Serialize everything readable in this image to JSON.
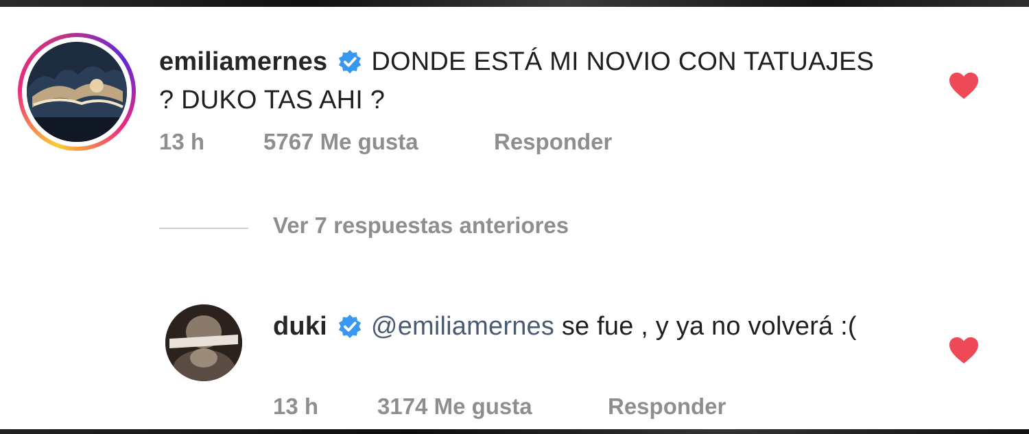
{
  "comments": [
    {
      "username": "emiliamernes",
      "text": "DONDE ESTÁ MI NOVIO CON TATUAJES ? DUKO TAS AHI ?",
      "time": "13 h",
      "likes": "5767 Me gusta",
      "reply_label": "Responder",
      "liked": true
    }
  ],
  "view_replies_label": "Ver 7 respuestas anteriores",
  "reply": {
    "username": "duki",
    "mention": "@emiliamernes",
    "text": " se fue , y ya no volverá :(",
    "time": "13 h",
    "likes": "3174 Me gusta",
    "reply_label": "Responder",
    "liked": true
  },
  "colors": {
    "heart": "#ed4956",
    "verified": "#3897f0",
    "meta": "#8e8e8e",
    "mention": "#4a5a72"
  },
  "icons": {
    "verified": "verified-badge-icon",
    "heart": "heart-filled-icon"
  }
}
